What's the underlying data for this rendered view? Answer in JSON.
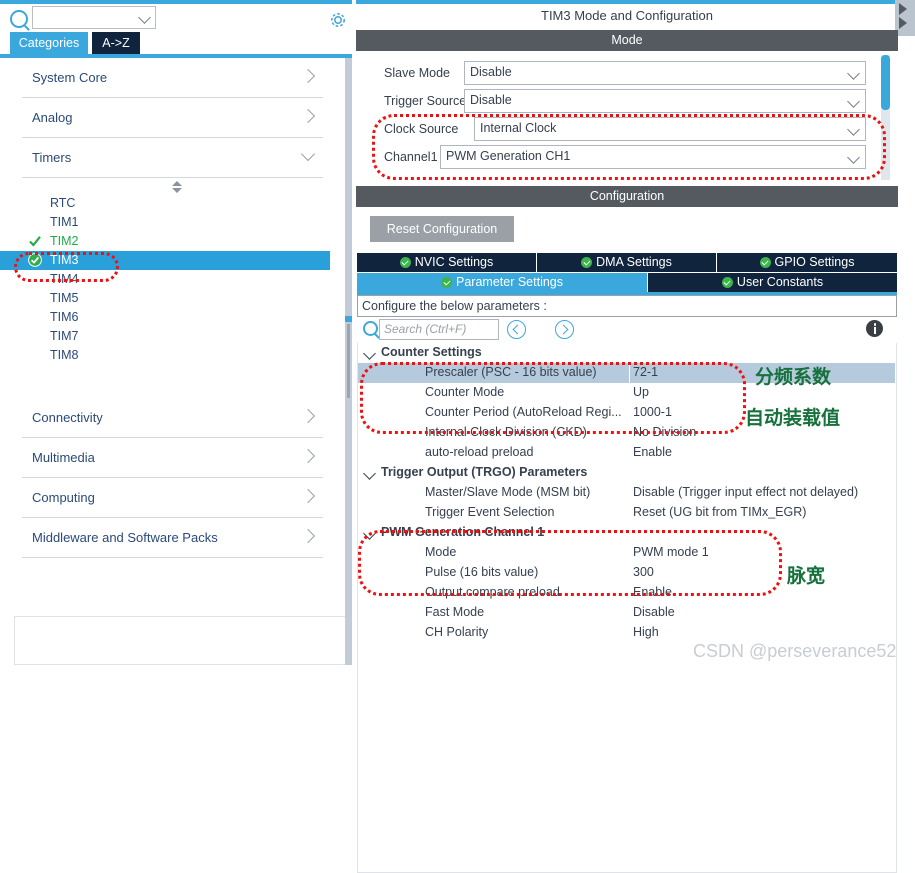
{
  "app": {
    "title": "TIM3 Mode and Configuration",
    "mode_header": "Mode",
    "configuration_header": "Configuration"
  },
  "sidebar": {
    "search": {
      "value": "",
      "placeholder": ""
    },
    "gear_label": "settings",
    "tabs": [
      {
        "label": "Categories",
        "active": true
      },
      {
        "label": "A->Z",
        "active": false
      }
    ],
    "categories": [
      {
        "label": "System Core",
        "expanded": false
      },
      {
        "label": "Analog",
        "expanded": false
      },
      {
        "label": "Timers",
        "expanded": true
      }
    ],
    "timers": [
      {
        "label": "RTC",
        "checked": false,
        "selected": false
      },
      {
        "label": "TIM1",
        "checked": false,
        "selected": false
      },
      {
        "label": "TIM2",
        "checked": true,
        "selected": false
      },
      {
        "label": "TIM3",
        "checked": true,
        "selected": true
      },
      {
        "label": "TIM4",
        "checked": false,
        "selected": false
      },
      {
        "label": "TIM5",
        "checked": false,
        "selected": false
      },
      {
        "label": "TIM6",
        "checked": false,
        "selected": false
      },
      {
        "label": "TIM7",
        "checked": false,
        "selected": false
      },
      {
        "label": "TIM8",
        "checked": false,
        "selected": false
      }
    ],
    "categories_bottom": [
      {
        "label": "Connectivity",
        "expanded": false
      },
      {
        "label": "Multimedia",
        "expanded": false
      },
      {
        "label": "Computing",
        "expanded": false
      },
      {
        "label": "Middleware and Software Packs",
        "expanded": false
      }
    ]
  },
  "mode": {
    "rows": [
      {
        "label": "Slave Mode",
        "value": "Disable"
      },
      {
        "label": "Trigger Source",
        "value": "Disable"
      },
      {
        "label": "Clock Source",
        "value": "Internal Clock"
      },
      {
        "label": "Channel1",
        "value": "PWM Generation CH1"
      }
    ]
  },
  "configuration": {
    "reset_button": "Reset Configuration",
    "tabs_row1": [
      {
        "label": "NVIC Settings",
        "active": false
      },
      {
        "label": "DMA Settings",
        "active": false
      },
      {
        "label": "GPIO Settings",
        "active": false
      }
    ],
    "tabs_row2": [
      {
        "label": "Parameter Settings",
        "active": true
      },
      {
        "label": "User Constants",
        "active": false
      }
    ],
    "note": "Configure the below parameters :",
    "search": {
      "value": "",
      "placeholder": "Search (Ctrl+F)"
    },
    "tree": [
      {
        "kind": "group",
        "label": "Counter Settings",
        "expanded": true
      },
      {
        "kind": "param",
        "label": "Prescaler (PSC - 16 bits value)",
        "value": "72-1",
        "highlighted": true
      },
      {
        "kind": "param",
        "label": "Counter Mode",
        "value": "Up",
        "highlighted": false
      },
      {
        "kind": "param",
        "label": "Counter Period (AutoReload Regi...",
        "value": "1000-1",
        "highlighted": false
      },
      {
        "kind": "param",
        "label": "Internal Clock Division (CKD)",
        "value": "No Division",
        "highlighted": false
      },
      {
        "kind": "param",
        "label": "auto-reload preload",
        "value": "Enable",
        "highlighted": false
      },
      {
        "kind": "group",
        "label": "Trigger Output (TRGO) Parameters",
        "expanded": true
      },
      {
        "kind": "param",
        "label": "Master/Slave Mode (MSM bit)",
        "value": "Disable (Trigger input effect not delayed)",
        "highlighted": false
      },
      {
        "kind": "param",
        "label": "Trigger Event Selection",
        "value": "Reset (UG bit from TIMx_EGR)",
        "highlighted": false
      },
      {
        "kind": "group",
        "label": "PWM Generation Channel 1",
        "expanded": true
      },
      {
        "kind": "param",
        "label": "Mode",
        "value": "PWM mode 1",
        "highlighted": false
      },
      {
        "kind": "param",
        "label": "Pulse (16 bits value)",
        "value": "300",
        "highlighted": false
      },
      {
        "kind": "param",
        "label": "Output compare preload",
        "value": "Enable",
        "highlighted": false
      },
      {
        "kind": "param",
        "label": "Fast Mode",
        "value": "Disable",
        "highlighted": false
      },
      {
        "kind": "param",
        "label": "CH Polarity",
        "value": "High",
        "highlighted": false
      }
    ]
  },
  "annotations": {
    "color": "#17713c",
    "box_color": "#ee1111",
    "notes": [
      {
        "text": "分频系数"
      },
      {
        "text": "自动装载值"
      },
      {
        "text": "脉宽"
      }
    ]
  },
  "watermark": "CSDN @perseverance52"
}
